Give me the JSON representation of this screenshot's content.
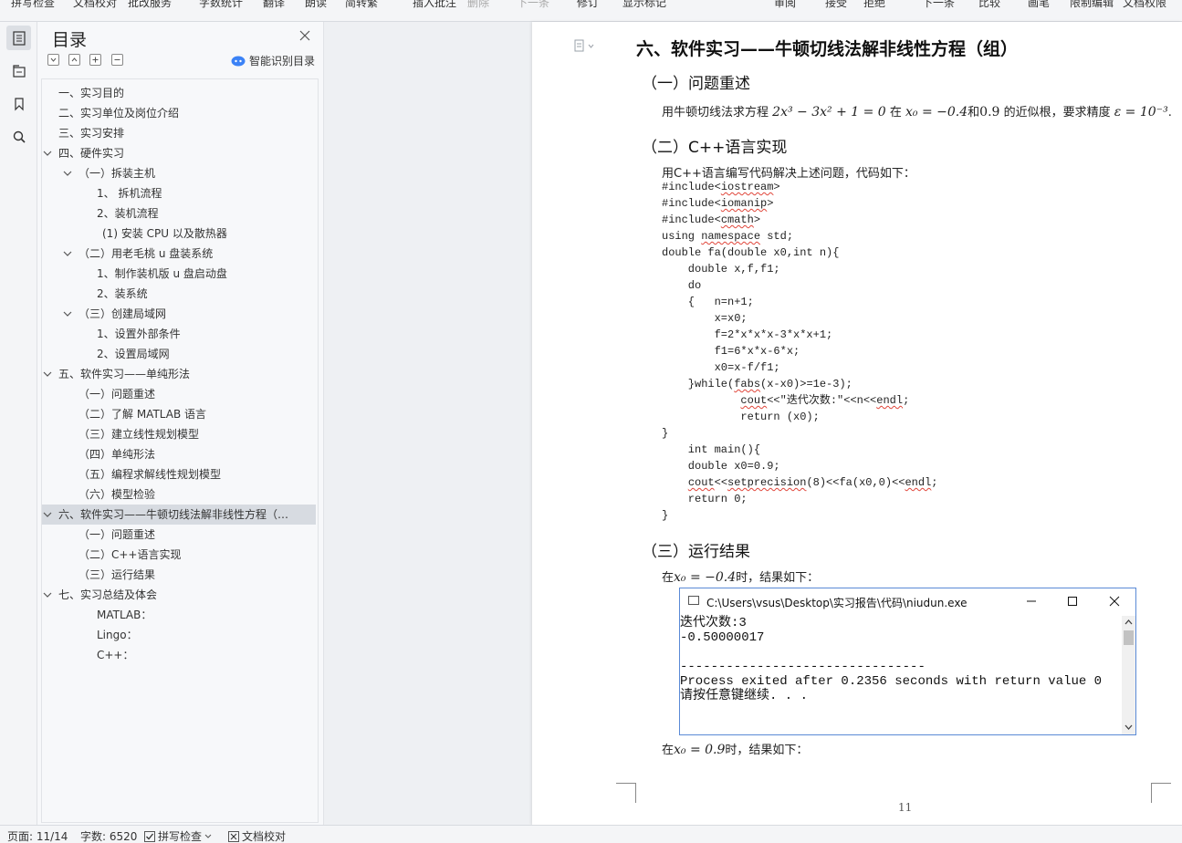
{
  "ribbon": {
    "items": [
      "拼写检查",
      "文档校对",
      "批改服务",
      "字数统计",
      "翻译",
      "朗读",
      "简转繁",
      "插入批注",
      "删除",
      "下一条",
      "修订",
      "显示标记",
      "审阅",
      "接受",
      "拒绝",
      "下一条",
      "比较",
      "画笔",
      "限制编辑",
      "文档权限"
    ]
  },
  "toc": {
    "title": "目录",
    "smart_label": "智能识别目录",
    "items": [
      {
        "label": "一、实习目的",
        "level": 1,
        "expandable": false,
        "selected": false
      },
      {
        "label": "二、实习单位及岗位介绍",
        "level": 1,
        "expandable": false,
        "selected": false
      },
      {
        "label": "三、实习安排",
        "level": 1,
        "expandable": false,
        "selected": false
      },
      {
        "label": "四、硬件实习",
        "level": 1,
        "expandable": true,
        "selected": false
      },
      {
        "label": "（一）拆装主机",
        "level": 2,
        "expandable": true,
        "selected": false
      },
      {
        "label": "1、 拆机流程",
        "level": 3,
        "expandable": false,
        "selected": false
      },
      {
        "label": "2、装机流程",
        "level": 3,
        "expandable": false,
        "selected": false
      },
      {
        "label": "(1) 安装 CPU 以及散热器",
        "level": 3.2,
        "expandable": false,
        "selected": false
      },
      {
        "label": "（二）用老毛桃 u 盘装系统",
        "level": 2,
        "expandable": true,
        "selected": false
      },
      {
        "label": "1、制作装机版 u 盘启动盘",
        "level": 3,
        "expandable": false,
        "selected": false
      },
      {
        "label": "2、装系统",
        "level": 3,
        "expandable": false,
        "selected": false
      },
      {
        "label": "（三）创建局域网",
        "level": 2,
        "expandable": true,
        "selected": false
      },
      {
        "label": "1、设置外部条件",
        "level": 3,
        "expandable": false,
        "selected": false
      },
      {
        "label": "2、设置局域网",
        "level": 3,
        "expandable": false,
        "selected": false
      },
      {
        "label": "五、软件实习——单纯形法",
        "level": 1,
        "expandable": true,
        "selected": false
      },
      {
        "label": "（一）问题重述",
        "level": 2,
        "expandable": false,
        "selected": false
      },
      {
        "label": "（二）了解 MATLAB 语言",
        "level": 2,
        "expandable": false,
        "selected": false
      },
      {
        "label": "（三）建立线性规划模型",
        "level": 2,
        "expandable": false,
        "selected": false
      },
      {
        "label": "（四）单纯形法",
        "level": 2,
        "expandable": false,
        "selected": false
      },
      {
        "label": "（五）编程求解线性规划模型",
        "level": 2,
        "expandable": false,
        "selected": false
      },
      {
        "label": "（六）模型检验",
        "level": 2,
        "expandable": false,
        "selected": false
      },
      {
        "label": "六、软件实习——牛顿切线法解非线性方程（…",
        "level": 1,
        "expandable": true,
        "selected": true
      },
      {
        "label": "（一）问题重述",
        "level": 2,
        "expandable": false,
        "selected": false
      },
      {
        "label": "（二）C++语言实现",
        "level": 2,
        "expandable": false,
        "selected": false
      },
      {
        "label": "（三）运行结果",
        "level": 2,
        "expandable": false,
        "selected": false
      },
      {
        "label": "七、实习总结及体会",
        "level": 1,
        "expandable": true,
        "selected": false
      },
      {
        "label": "MATLAB：",
        "level": 3,
        "expandable": false,
        "selected": false
      },
      {
        "label": "Lingo：",
        "level": 3,
        "expandable": false,
        "selected": false
      },
      {
        "label": "C++：",
        "level": 3,
        "expandable": false,
        "selected": false
      }
    ]
  },
  "doc": {
    "h1": "六、软件实习——牛顿切线法解非线性方程（组）",
    "s1": "（一）问题重述",
    "p1_a": "用牛顿切线法求方程",
    "p1_eq": "2x³ − 3x² + 1 = 0",
    "p1_b": "在",
    "p1_x0": "x₀ = −0.4",
    "p1_c": "和",
    "p1_x1": "0.9",
    "p1_d": "的近似根，要求精度",
    "p1_eps": "ε = 10⁻³",
    "p1_e": ".",
    "s2": "（二）C++语言实现",
    "p2": "用C++语言编写代码解决上述问题，代码如下：",
    "code": [
      "#include<iostream>",
      "#include<iomanip>",
      "#include<cmath>",
      "using namespace std;",
      "double fa(double x0,int n){",
      "    double x,f,f1;",
      "    do",
      "    {   n=n+1;",
      "        x=x0;",
      "        f=2*x*x*x-3*x*x+1;",
      "        f1=6*x*x-6*x;",
      "        x0=x-f/f1;",
      "    }while(fabs(x-x0)>=1e-3);",
      "            cout<<\"迭代次数:\"<<n<<endl;",
      "            return (x0);",
      "}",
      "    int main(){",
      "    double x0=0.9;",
      "    cout<<setprecision(8)<<fa(x0,0)<<endl;",
      "    return 0;",
      "}"
    ],
    "s3": "（三）运行结果",
    "r1_a": "在",
    "r1_eq": "x₀ = −0.4",
    "r1_b": "时，结果如下：",
    "r2_a": "在",
    "r2_eq": "x₀ = 0.9",
    "r2_b": "时，结果如下：",
    "page_number": "11"
  },
  "console": {
    "title": "C:\\Users\\vsus\\Desktop\\实习报告\\代码\\niudun.exe",
    "lines": [
      "迭代次数:3",
      "-0.50000017",
      "",
      "--------------------------------",
      "Process exited after 0.2356 seconds with return value 0",
      "请按任意键继续. . ."
    ]
  },
  "status": {
    "page": "页面: 11/14",
    "words": "字数: 6520",
    "spell": "拼写检查",
    "proof": "文档校对"
  }
}
